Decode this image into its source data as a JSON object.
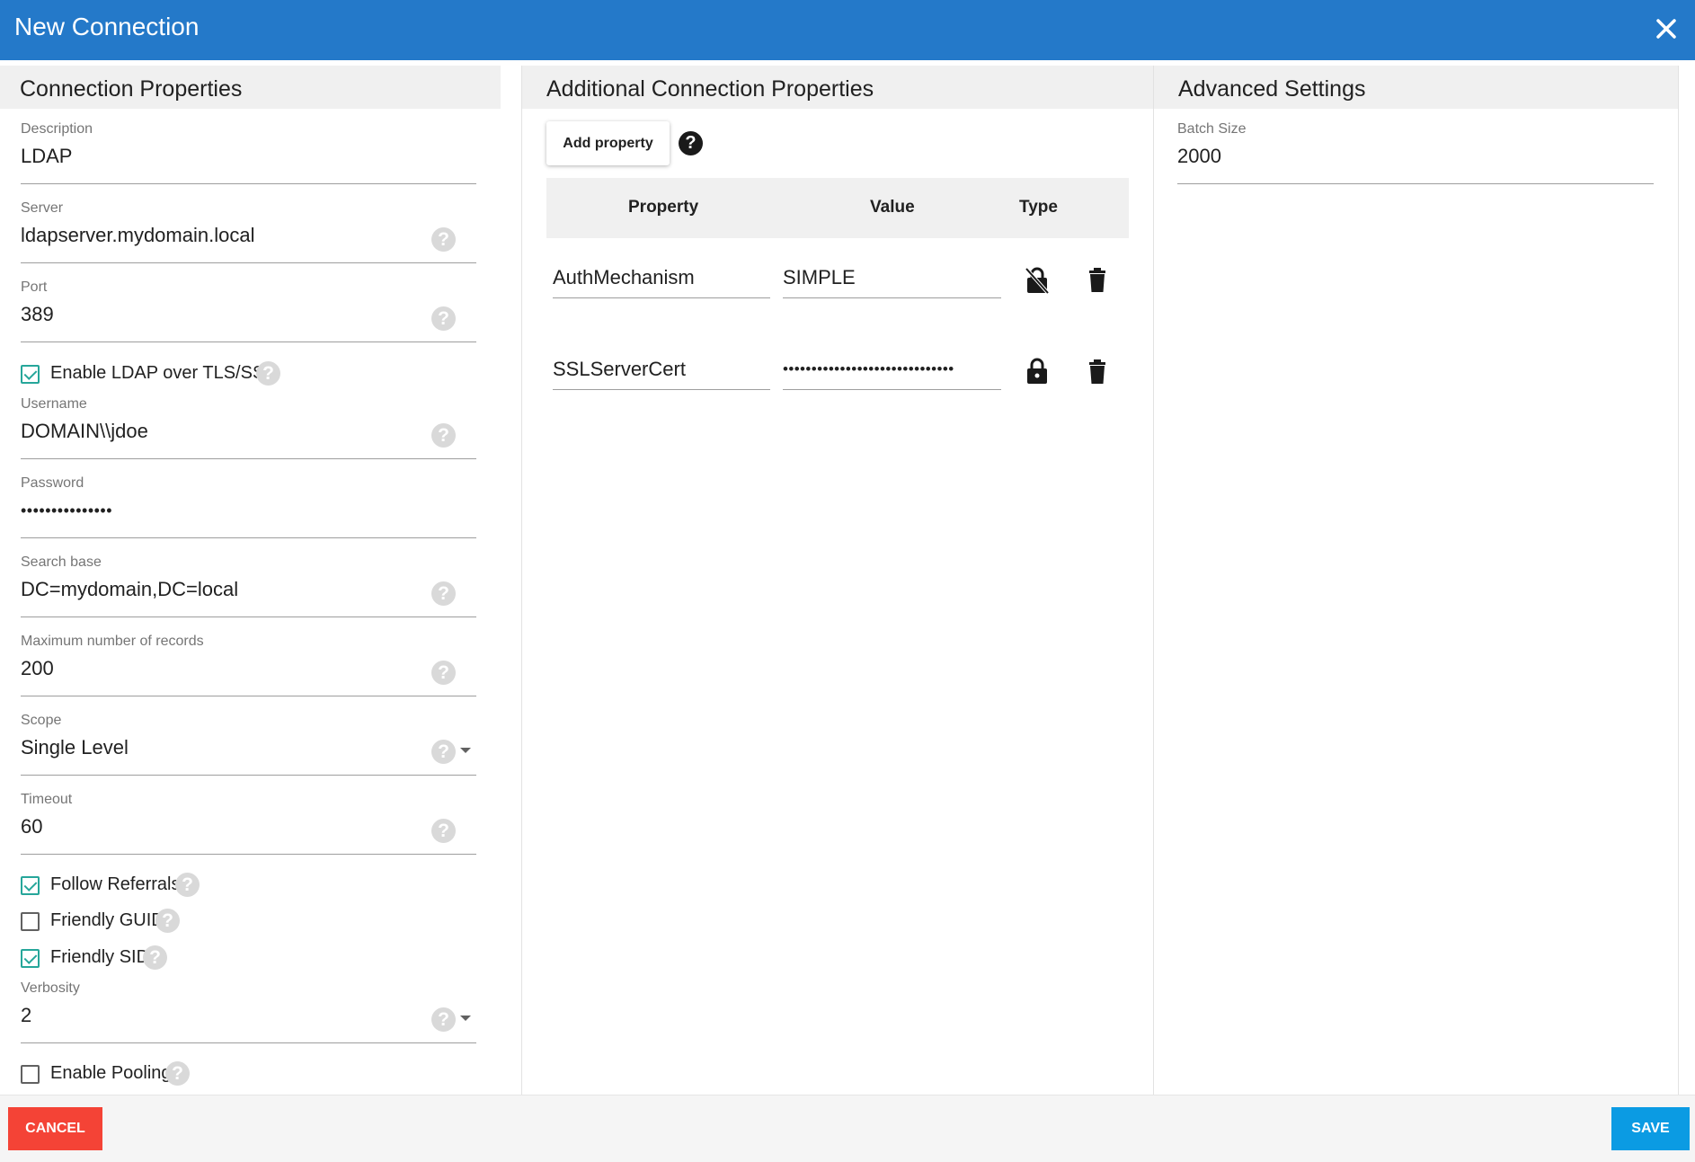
{
  "dialog": {
    "title": "New Connection",
    "close_icon": "close-icon"
  },
  "connection_properties": {
    "header": "Connection Properties",
    "fields": {
      "description": {
        "label": "Description",
        "value": "LDAP"
      },
      "server": {
        "label": "Server",
        "value": "ldapserver.mydomain.local"
      },
      "port": {
        "label": "Port",
        "value": "389"
      },
      "username": {
        "label": "Username",
        "value": "DOMAIN\\\\jdoe"
      },
      "password": {
        "label": "Password",
        "value": "•••••••••••••••"
      },
      "search_base": {
        "label": "Search base",
        "value": "DC=mydomain,DC=local"
      },
      "max_records": {
        "label": "Maximum number of records",
        "value": "200"
      },
      "scope": {
        "label": "Scope",
        "value": "Single Level"
      },
      "timeout": {
        "label": "Timeout",
        "value": "60"
      },
      "verbosity": {
        "label": "Verbosity",
        "value": "2"
      }
    },
    "checkboxes": {
      "enable_tls": {
        "label": "Enable LDAP over TLS/SSL",
        "checked": true
      },
      "follow_referrals": {
        "label": "Follow Referrals",
        "checked": true
      },
      "friendly_guid": {
        "label": "Friendly GUID",
        "checked": false
      },
      "friendly_sid": {
        "label": "Friendly SID",
        "checked": true
      },
      "enable_pooling": {
        "label": "Enable Pooling",
        "checked": false
      }
    },
    "help_glyph": "?"
  },
  "additional_properties": {
    "header": "Additional Connection Properties",
    "add_button": "Add property",
    "help_glyph": "?",
    "columns": {
      "property": "Property",
      "value": "Value",
      "type": "Type"
    },
    "rows": [
      {
        "property": "AuthMechanism",
        "value": "SIMPLE",
        "type_icon": "unlocked-icon"
      },
      {
        "property": "SSLServerCert",
        "value": "••••••••••••••••••••••••••••••",
        "type_icon": "lock-icon"
      }
    ]
  },
  "advanced_settings": {
    "header": "Advanced Settings",
    "batch_size": {
      "label": "Batch Size",
      "value": "2000"
    }
  },
  "footer": {
    "cancel": "CANCEL",
    "save": "SAVE"
  },
  "colors": {
    "title_bar": "#2479c9",
    "checkbox": "#26a69a",
    "cancel": "#f44336",
    "save": "#0b9be3"
  }
}
